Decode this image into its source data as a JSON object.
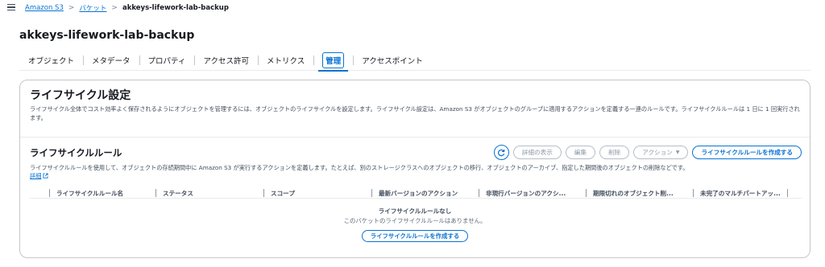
{
  "breadcrumb": {
    "items": [
      "Amazon S3",
      "バケット"
    ],
    "current": "akkeys-lifework-lab-backup",
    "separator": ">"
  },
  "bucket_title": "akkeys-lifework-lab-backup",
  "tabs": [
    {
      "label": "オブジェクト"
    },
    {
      "label": "メタデータ"
    },
    {
      "label": "プロパティ"
    },
    {
      "label": "アクセス許可"
    },
    {
      "label": "メトリクス"
    },
    {
      "label": "管理",
      "active": true
    },
    {
      "label": "アクセスポイント"
    }
  ],
  "lifecycle_config": {
    "title": "ライフサイクル設定",
    "description": "ライフサイクル全体でコスト効率よく保存されるようにオブジェクトを管理するには、オブジェクトのライフサイクルを設定します。ライフサイクル設定は、Amazon S3 がオブジェクトのグループに適用するアクションを定義する一連のルールです。ライフサイクルルールは 1 日に 1 回実行されます。"
  },
  "lifecycle_rules": {
    "title": "ライフサイクルルール",
    "description": "ライフサイクルルールを使用して、オブジェクトの存続期間中に Amazon S3 が実行するアクションを定義します。たとえば、別のストレージクラスへのオブジェクトの移行、オブジェクトのアーカイブ、指定した期間後のオブジェクトの削除などです。",
    "learn_more": "詳細",
    "buttons": {
      "view_details": "詳細の表示",
      "edit": "編集",
      "delete": "削除",
      "actions": "アクション",
      "create": "ライフサイクルルールを作成する"
    },
    "columns": [
      "ライフサイクルルール名",
      "ステータス",
      "スコープ",
      "最新バージョンのアクション",
      "非現行バージョンのアクシ...",
      "期限切れのオブジェクト削...",
      "未完了のマルチパートアッ..."
    ],
    "empty_title": "ライフサイクルルールなし",
    "empty_desc": "このバケットのライフサイクルルールはありません。",
    "empty_button": "ライフサイクルルールを作成する"
  },
  "colors": {
    "accent": "#0972d3",
    "text": "#16191f",
    "muted": "#414d5c",
    "border": "#c6c6cd"
  },
  "icons": [
    "menu-icon",
    "refresh-icon",
    "external-link-icon",
    "caret-down-icon"
  ]
}
